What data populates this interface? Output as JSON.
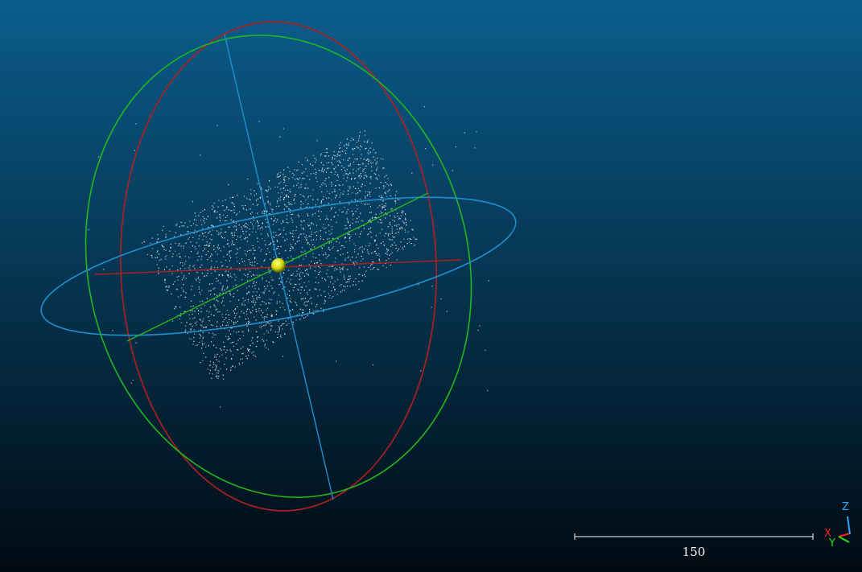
{
  "viewport": {
    "background_top": "#0b5d8c",
    "background_bottom": "#000a12",
    "point_color": "#ffffff"
  },
  "gizmo": {
    "center_sphere_color": "#e6e61a",
    "ring_colors": {
      "x_ring": "#b22020",
      "y_ring": "#1fb81f",
      "z_ring": "#1e90d0"
    }
  },
  "scale_bar": {
    "label": "150",
    "color": "#ffffff"
  },
  "axis_triad": {
    "x": {
      "label": "X",
      "color": "#ff2020"
    },
    "y": {
      "label": "Y",
      "color": "#20e020"
    },
    "z": {
      "label": "Z",
      "color": "#2aa8ff"
    }
  }
}
